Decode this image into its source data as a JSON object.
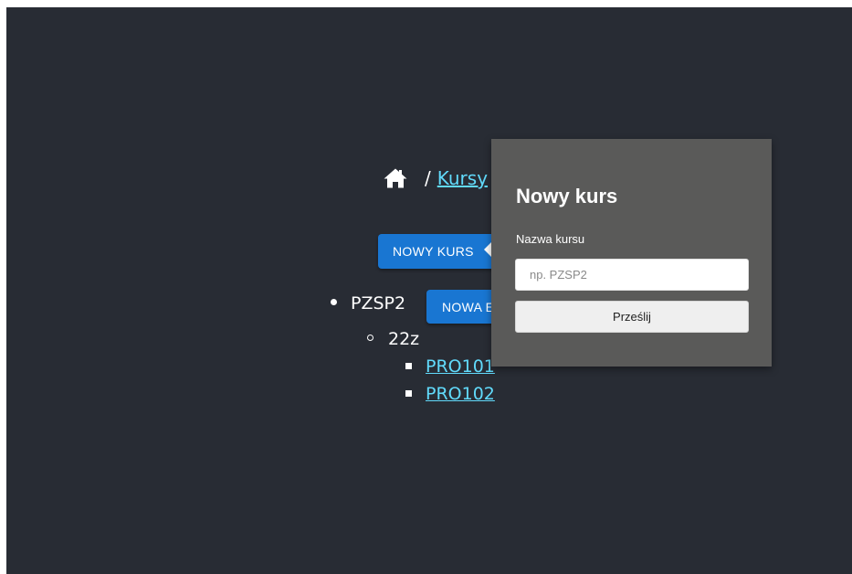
{
  "breadcrumb": {
    "separator": "/",
    "current_link": "Kursy"
  },
  "actions": {
    "new_course_label": "NOWY KURS",
    "new_edition_label": "NOWA EDYCJA"
  },
  "tree": {
    "courses": [
      {
        "name": "PZSP2",
        "editions": [
          {
            "name": "22z",
            "items": [
              "PRO101",
              "PRO102"
            ]
          }
        ]
      }
    ]
  },
  "popover": {
    "title": "Nowy kurs",
    "field_label": "Nazwa kursu",
    "input_value": "",
    "input_placeholder": "np. PZSP2",
    "submit_label": "Prześlij"
  },
  "colors": {
    "background": "#282c34",
    "link": "#61dafb",
    "primary_button": "#1976d2",
    "popover_background": "#5a5a59"
  },
  "icons": {
    "home": "home-icon"
  }
}
